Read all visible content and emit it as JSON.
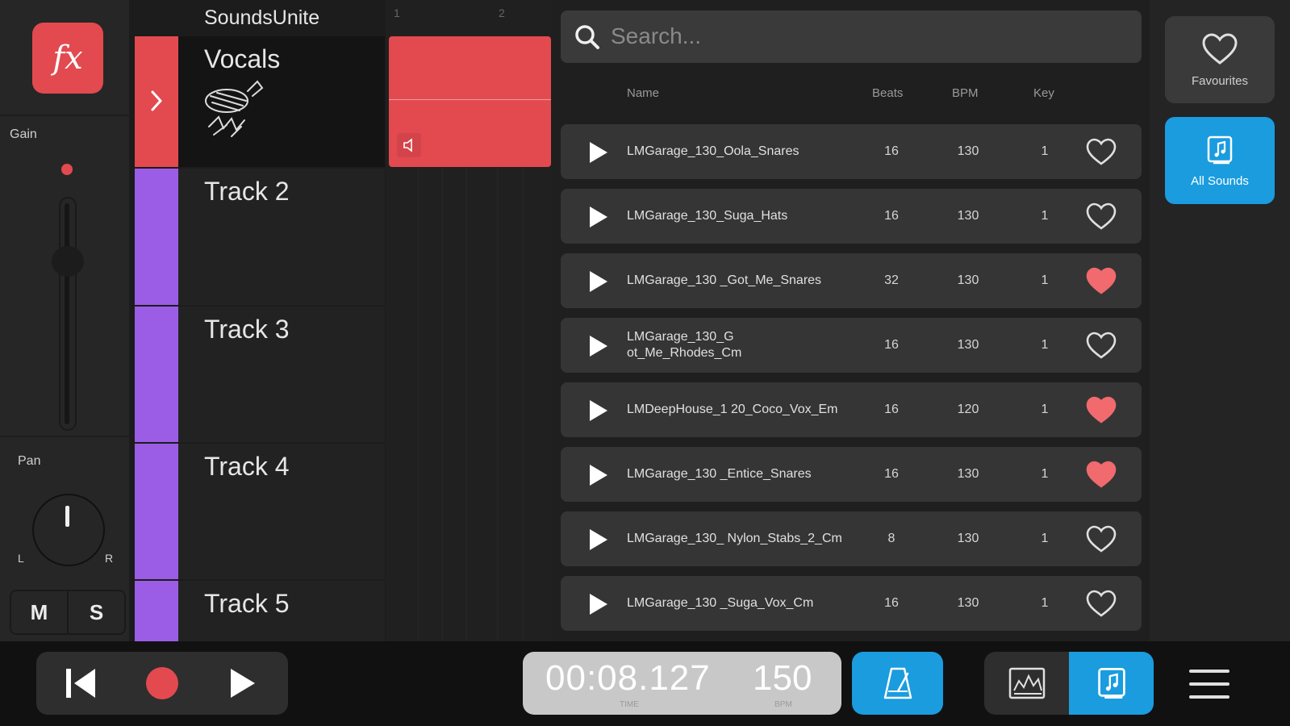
{
  "mixer": {
    "fx_label": "fx",
    "gain_label": "Gain",
    "pan_label": "Pan",
    "pan_left": "L",
    "pan_right": "R",
    "mute_label": "M",
    "solo_label": "S"
  },
  "tracks": {
    "title": "SoundsUnite",
    "items": [
      {
        "name": "Vocals",
        "color": "#e24a4f",
        "icon": "vocals-doodle-icon"
      },
      {
        "name": "Track 2",
        "color": "#9b5de5"
      },
      {
        "name": "Track 3",
        "color": "#9b5de5"
      },
      {
        "name": "Track 4",
        "color": "#9b5de5"
      },
      {
        "name": "Track 5",
        "color": "#9b5de5"
      }
    ]
  },
  "timeline": {
    "ruler": [
      "1",
      "2"
    ]
  },
  "browser": {
    "search_placeholder": "Search...",
    "columns": {
      "name": "Name",
      "beats": "Beats",
      "bpm": "BPM",
      "key": "Key"
    },
    "rows": [
      {
        "name": "LMGarage_130_Oola_Snares",
        "beats": "16",
        "bpm": "130",
        "key": "1",
        "favourite": false
      },
      {
        "name": "LMGarage_130_Suga_Hats",
        "beats": "16",
        "bpm": "130",
        "key": "1",
        "favourite": false
      },
      {
        "name": "LMGarage_130 _Got_Me_Snares",
        "beats": "32",
        "bpm": "130",
        "key": "1",
        "favourite": true
      },
      {
        "name": "LMGarage_130_G ot_Me_Rhodes_Cm",
        "beats": "16",
        "bpm": "130",
        "key": "1",
        "favourite": false
      },
      {
        "name": "LMDeepHouse_1 20_Coco_Vox_Em",
        "beats": "16",
        "bpm": "120",
        "key": "1",
        "favourite": true
      },
      {
        "name": "LMGarage_130 _Entice_Snares",
        "beats": "16",
        "bpm": "130",
        "key": "1",
        "favourite": true
      },
      {
        "name": "LMGarage_130_ Nylon_Stabs_2_Cm",
        "beats": "8",
        "bpm": "130",
        "key": "1",
        "favourite": false
      },
      {
        "name": "LMGarage_130 _Suga_Vox_Cm",
        "beats": "16",
        "bpm": "130",
        "key": "1",
        "favourite": false
      }
    ]
  },
  "sidebar": {
    "favourites_label": "Favourites",
    "all_sounds_label": "All Sounds"
  },
  "transport": {
    "time": "00:08.127",
    "time_caption": "TIME",
    "bpm": "150",
    "bpm_caption": "BPM"
  },
  "colors": {
    "accent_red": "#e24a4f",
    "accent_blue": "#1a9cdf",
    "track_purple": "#9b5de5",
    "fav_filled": "#f06a6e"
  }
}
